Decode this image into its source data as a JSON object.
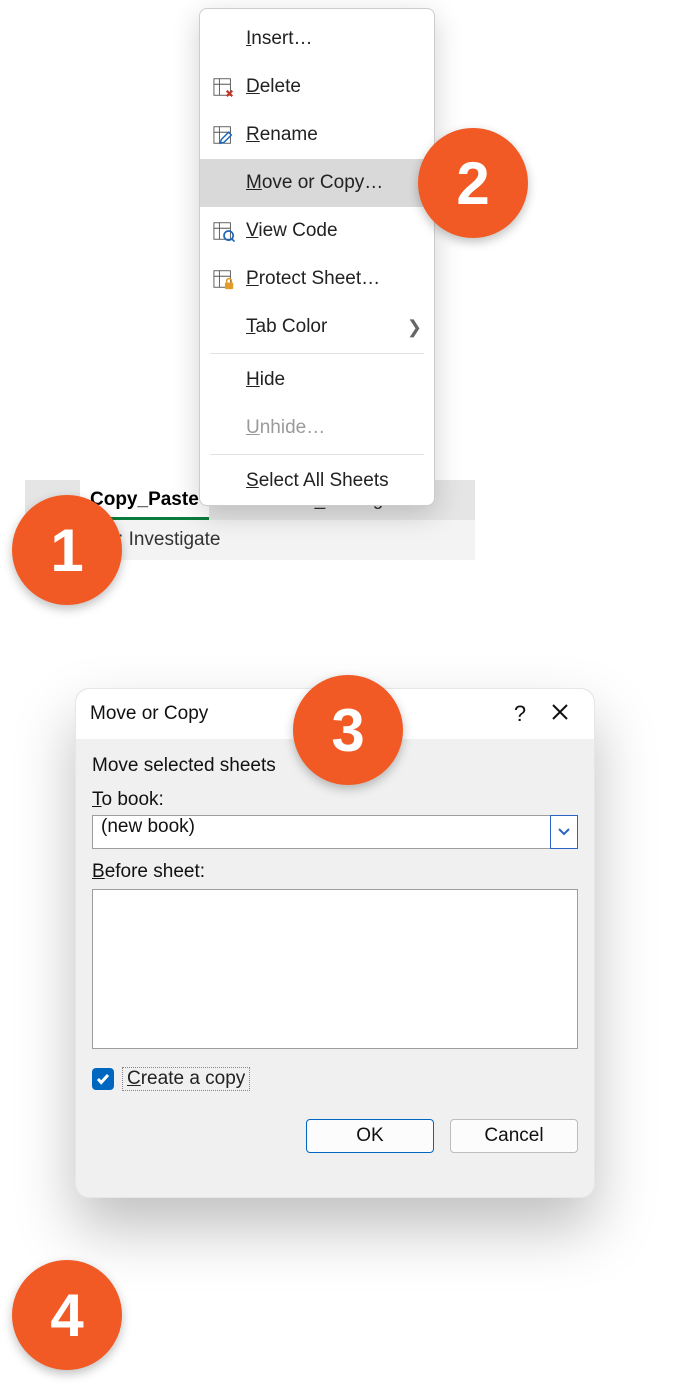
{
  "tabs": {
    "active": "Copy_Paste",
    "inactive": "Formula_Editing"
  },
  "statusbar": {
    "text": "bility: Investigate"
  },
  "menu": {
    "insert": "Insert…",
    "delete": "Delete",
    "rename": "Rename",
    "move_or_copy": "Move or Copy…",
    "view_code": "View Code",
    "protect": "Protect Sheet…",
    "tab_color": "Tab Color",
    "hide": "Hide",
    "unhide": "Unhide…",
    "select_all": "Select All Sheets"
  },
  "badges": {
    "b1": "1",
    "b2": "2",
    "b3": "3",
    "b4": "4"
  },
  "dialog": {
    "title": "Move or Copy",
    "instruction": "Move selected sheets",
    "to_book_label": "To book:",
    "to_book_value": "(new book)",
    "before_label": "Before sheet:",
    "create_copy": "Create a copy",
    "create_copy_checked": true,
    "ok": "OK",
    "cancel": "Cancel"
  }
}
